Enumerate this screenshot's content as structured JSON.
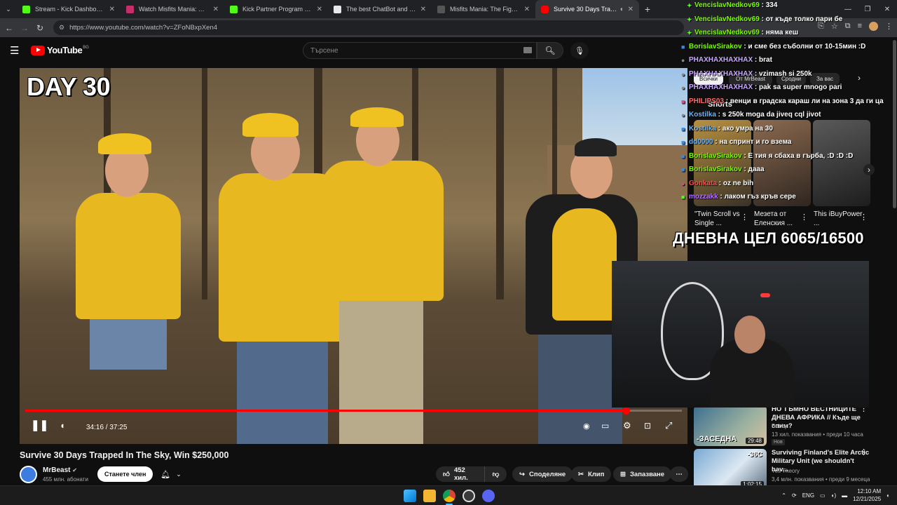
{
  "browser": {
    "tabs": [
      {
        "title": "Stream - Kick Dashboard",
        "color": "#53fc18"
      },
      {
        "title": "Watch Misfits Mania: Andrew Tate",
        "color": "#c62d6b"
      },
      {
        "title": "Kick Partner Program - Kick Das",
        "color": "#53fc18"
      },
      {
        "title": "The best ChatBot and Widgets",
        "color": "#e8e8e8"
      },
      {
        "title": "Misfits Mania: The Fight Before",
        "color": "#555555"
      },
      {
        "title": "Survive 30 Days Trapped In",
        "color": "#ff0000",
        "active": true
      }
    ],
    "url": "https://www.youtube.com/watch?v=ZFoNBxpXen4"
  },
  "youtube": {
    "logo_text": "YouTube",
    "region": "BG",
    "search_placeholder": "Търсене"
  },
  "video": {
    "overlay_text": "DAY 30",
    "progress": 0.915,
    "timecode": "34:16 / 37:25",
    "title": "Survive 30 Days Trapped In The Sky, Win $250,000",
    "channel": "MrBeast",
    "subscribers": "455 млн. абонати",
    "join_label": "Станете член",
    "like_count": "452 хил.",
    "share_label": "Споделяне",
    "clip_label": "Клип",
    "save_label": "Запазване"
  },
  "chat": [
    {
      "user": "VencislavNedkov69",
      "text": "334",
      "color": "#7cfc00"
    },
    {
      "user": "VencislavNedkov69",
      "text": "от къде толко пари бе",
      "color": "#7cfc00"
    },
    {
      "user": "VencislavNedkov69",
      "text": "няма кеш",
      "color": "#7cfc00"
    },
    {
      "user": "BorislavSirakov",
      "text": "и сме без съболни от 10-15мин :D",
      "color": "#7cfc00"
    },
    {
      "user": "PHAXHAXHAXHAX",
      "text": "brat",
      "color": "#c9a8ff"
    },
    {
      "user": "PHAXHAXHAXHAX",
      "text": "vzimash si 250k",
      "color": "#c9a8ff"
    },
    {
      "user": "PHAXHAXHAXHAX",
      "text": "pak sa super mnogo pari",
      "color": "#c9a8ff"
    },
    {
      "user": "PHILIPS03",
      "text": "венци в градска караш ли на зона 3 да ги ца",
      "color": "#ff6b6b"
    },
    {
      "user": "Kostilka",
      "text": "s 250k moga da jiveq cql jivot",
      "color": "#6bb6ff"
    },
    {
      "user": "Kostilka",
      "text": "ако умра на 30",
      "color": "#6bb6ff"
    },
    {
      "user": "dd0000",
      "text": "на спринт и го взема",
      "color": "#6bb6ff"
    },
    {
      "user": "BorislavSirakov",
      "text": "Е тия я сбаха в гърба, :D :D :D",
      "color": "#7cfc00"
    },
    {
      "user": "BorislavSirakov",
      "text": "дааа",
      "color": "#7cfc00"
    },
    {
      "user": "Gonkata",
      "text": "oz ne bih",
      "color": "#ff4d4d"
    },
    {
      "user": "mozzakk",
      "text": "лаком гъз кръв сере",
      "color": "#b070ff"
    }
  ],
  "sidebar": {
    "chips": [
      "Всички",
      "От MrBeast",
      "Сродни",
      "За вас"
    ],
    "shorts_label": "Shorts",
    "shorts": [
      {
        "title": "\"Twin Scroll vs Single ..."
      },
      {
        "title": "Мезета от Еленския ..."
      },
      {
        "title": "This iBuyPower ..."
      }
    ],
    "goal": "ДНЕВНА ЦЕЛ 6065/16500",
    "videos": [
      {
        "title": "НО ТЪМНО ВЕСТНИЦИТЕ ДНЕВА АФРИКА // Къде ще спим?",
        "channel": "Bobby",
        "meta": "13 хил. показвания • преди 10 часа",
        "badge": "Нов",
        "duration": "29:48",
        "thumb_text": "-ЗАСЕДНА"
      },
      {
        "title": "Surviving Finland's Elite Arctic Military Unit (we shouldn't hav...",
        "channel": "Yes Theory",
        "meta": "3,4 млн. показвания • преди 9 месеца",
        "badge": "",
        "duration": "1:02:15",
        "thumb_text": "-36C"
      }
    ]
  },
  "taskbar": {
    "lang": "ENG",
    "time": "12:10 AM",
    "date": "12/21/2025"
  },
  "colors": {
    "accent": "#ff0000",
    "bg": "#0f0f0f"
  }
}
